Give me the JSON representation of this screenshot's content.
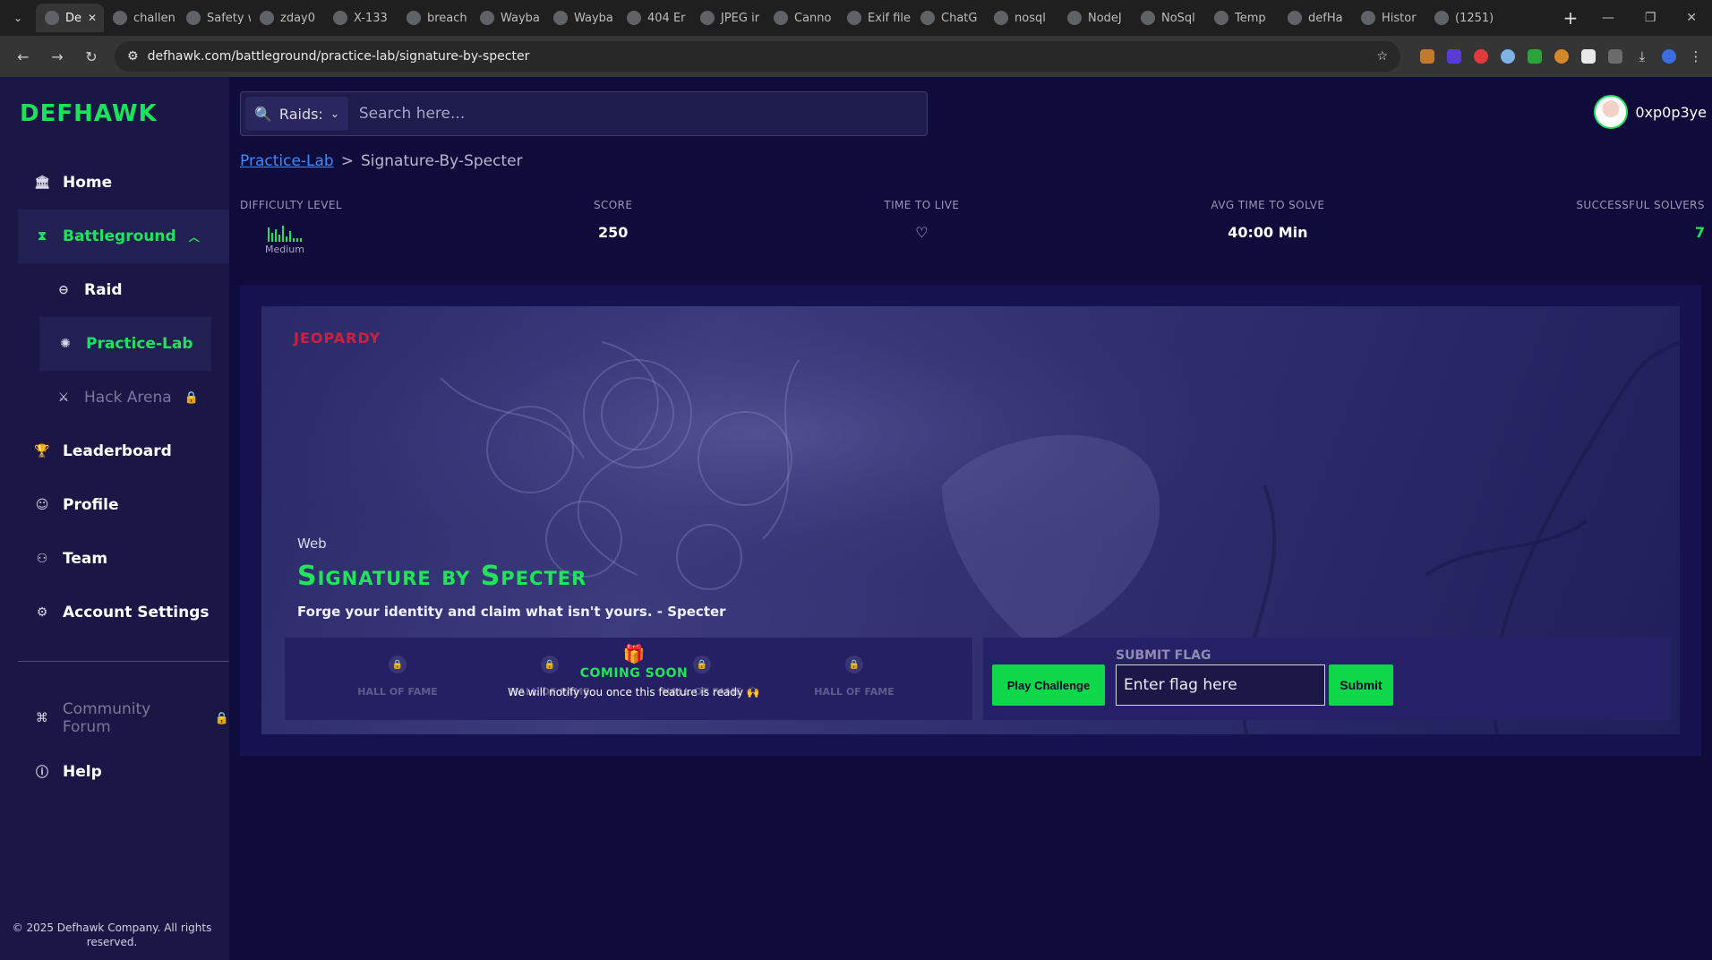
{
  "browser": {
    "tabs": [
      {
        "label": "De",
        "active": true
      },
      {
        "label": "challen"
      },
      {
        "label": "Safety wan"
      },
      {
        "label": "zday0"
      },
      {
        "label": "X-133"
      },
      {
        "label": "breach"
      },
      {
        "label": "Wayba"
      },
      {
        "label": "Wayba"
      },
      {
        "label": "404 Er"
      },
      {
        "label": "JPEG ir"
      },
      {
        "label": "Canno"
      },
      {
        "label": "Exif file"
      },
      {
        "label": "ChatG"
      },
      {
        "label": "nosql"
      },
      {
        "label": "NodeJ"
      },
      {
        "label": "NoSql"
      },
      {
        "label": "Temp"
      },
      {
        "label": "defHa"
      },
      {
        "label": "Histor"
      },
      {
        "label": "(1251)"
      }
    ],
    "url": "defhawk.com/battleground/practice-lab/signature-by-specter"
  },
  "brand": {
    "logo_text": "DEFHAWK",
    "accent": "#1ee35f"
  },
  "sidebar": {
    "items": [
      {
        "label": "Home",
        "icon": "bank-icon"
      },
      {
        "label": "Battleground",
        "icon": "hourglass-icon",
        "expanded": true
      },
      {
        "label": "Raid",
        "icon": "pill-icon"
      },
      {
        "label": "Practice-Lab",
        "icon": "atom-icon"
      },
      {
        "label": "Hack Arena",
        "icon": "arena-icon",
        "locked": true
      },
      {
        "label": "Leaderboard",
        "icon": "trophy-icon"
      },
      {
        "label": "Profile",
        "icon": "profile-icon"
      },
      {
        "label": "Team",
        "icon": "team-icon"
      },
      {
        "label": "Account Settings",
        "icon": "gear-icon"
      }
    ],
    "items2": [
      {
        "label": "Community Forum",
        "icon": "forum-icon",
        "locked": true
      },
      {
        "label": "Help",
        "icon": "help-icon"
      }
    ],
    "copyright": "© 2025 Defhawk Company. All rights reserved."
  },
  "search": {
    "scope": "Raids:",
    "placeholder": "Search here..."
  },
  "user": {
    "name": "0xp0p3ye"
  },
  "breadcrumb": {
    "parent": "Practice-Lab",
    "separator": ">",
    "current": "Signature-By-Specter"
  },
  "stats": {
    "difficulty_label": "DIFFICULTY LEVEL",
    "difficulty_value": "Medium",
    "score_label": "SCORE",
    "score_value": "250",
    "ttl_label": "TIME TO LIVE",
    "ttl_icon": "heart-icon",
    "avg_label": "AVG TIME TO SOLVE",
    "avg_value": "40:00 Min",
    "solvers_label": "SUCCESSFUL SOLVERS",
    "solvers_value": "7"
  },
  "challenge": {
    "tag": "JEOPARDY",
    "category": "Web",
    "title": "Signature by Specter",
    "description": "Forge your identity and claim what isn't yours. - Specter"
  },
  "hall_of_fame": {
    "slots": [
      "HALL OF FAME",
      "HALL OF FAME",
      "HALL OF FAME",
      "HALL OF FAME"
    ],
    "coming_soon": "COMING SOON",
    "notice": "We will notify you once this feature is ready 🙌"
  },
  "flag": {
    "play_label": "Play Challenge",
    "submit_heading": "SUBMIT FLAG",
    "input_placeholder": "Enter flag here",
    "submit_label": "Submit"
  }
}
